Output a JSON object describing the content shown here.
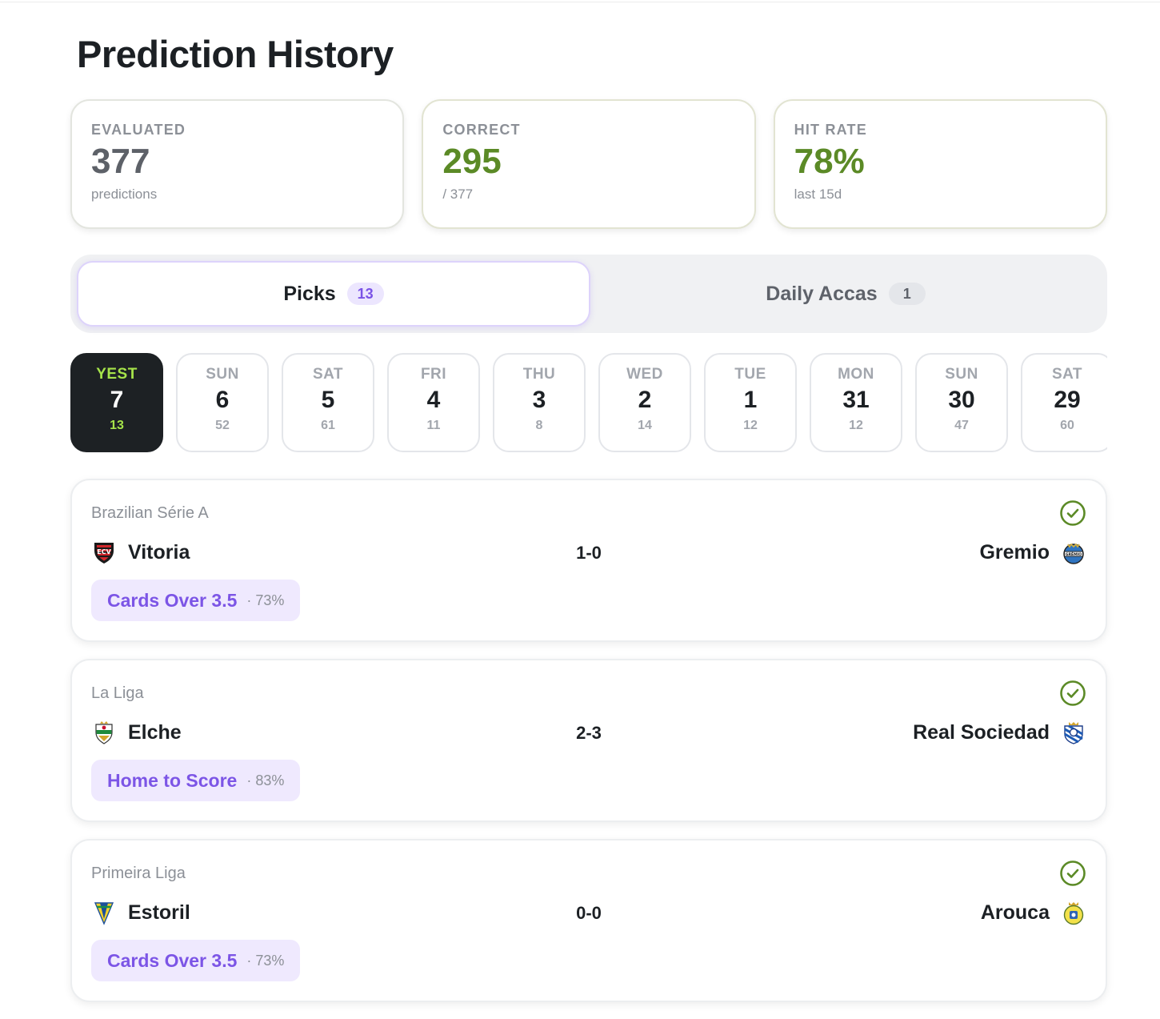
{
  "page": {
    "title": "Prediction History"
  },
  "stats": [
    {
      "label": "EVALUATED",
      "value": "377",
      "sub": "predictions"
    },
    {
      "label": "CORRECT",
      "value": "295",
      "sub": "/ 377"
    },
    {
      "label": "HIT RATE",
      "value": "78%",
      "sub": "last 15d"
    }
  ],
  "tabs": [
    {
      "label": "Picks",
      "count": "13",
      "active": true
    },
    {
      "label": "Daily Accas",
      "count": "1",
      "active": false
    }
  ],
  "days": [
    {
      "name": "YEST",
      "num": "7",
      "count": "13",
      "active": true
    },
    {
      "name": "SUN",
      "num": "6",
      "count": "52"
    },
    {
      "name": "SAT",
      "num": "5",
      "count": "61"
    },
    {
      "name": "FRI",
      "num": "4",
      "count": "11"
    },
    {
      "name": "THU",
      "num": "3",
      "count": "8"
    },
    {
      "name": "WED",
      "num": "2",
      "count": "14"
    },
    {
      "name": "TUE",
      "num": "1",
      "count": "12"
    },
    {
      "name": "MON",
      "num": "31",
      "count": "12"
    },
    {
      "name": "SUN",
      "num": "30",
      "count": "47"
    },
    {
      "name": "SAT",
      "num": "29",
      "count": "60"
    }
  ],
  "matches": [
    {
      "league": "Brazilian Série A",
      "home": "Vitoria",
      "away": "Gremio",
      "score": "1-0",
      "pick": "Cards Over 3.5",
      "confidence": "· 73%",
      "status": "check-icon"
    },
    {
      "league": "La Liga",
      "home": "Elche",
      "away": "Real Sociedad",
      "score": "2-3",
      "pick": "Home to Score",
      "confidence": "· 83%",
      "status": "check-icon"
    },
    {
      "league": "Primeira Liga",
      "home": "Estoril",
      "away": "Arouca",
      "score": "0-0",
      "pick": "Cards Over 3.5",
      "confidence": "· 73%",
      "status": "check-icon"
    }
  ],
  "colors": {
    "accent_purple": "#7c55e6",
    "success_green": "#5b8a26",
    "active_day_bg": "#1d2124",
    "active_day_text": "#a6e34a"
  }
}
